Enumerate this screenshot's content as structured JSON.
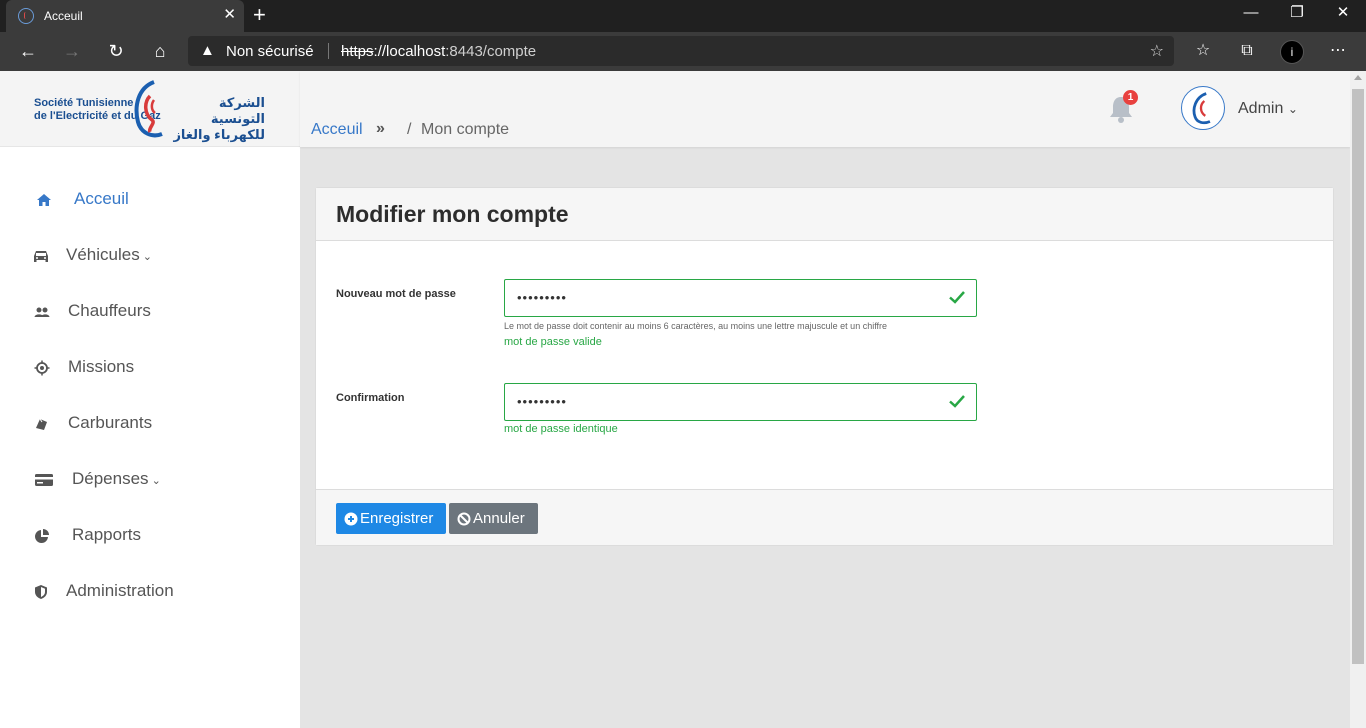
{
  "browser": {
    "tab_title": "Acceuil",
    "tab_close": "✕",
    "new_tab": "+",
    "security_label": "Non sécurisé",
    "url_scheme": "https",
    "url_host": "://localhost",
    "url_rest": ":8443/compte",
    "window_controls": [
      "—",
      "❐",
      "✕"
    ]
  },
  "logo": {
    "name_fr_line1": "Société Tunisienne",
    "name_fr_line2": "de l'Electricité et du Gaz",
    "name_ar_line1": "الشركة التونسية",
    "name_ar_line2": "للكهرباء والغاز"
  },
  "sidebar": {
    "items": [
      {
        "label": "Acceuil",
        "icon": "home-icon",
        "active": true
      },
      {
        "label": "Véhicules",
        "icon": "car-icon",
        "caret": "⌄"
      },
      {
        "label": "Chauffeurs",
        "icon": "people-icon"
      },
      {
        "label": "Missions",
        "icon": "target-icon"
      },
      {
        "label": "Carburants",
        "icon": "fuel-icon"
      },
      {
        "label": "Dépenses",
        "icon": "credit-card-icon",
        "caret": "⌄"
      },
      {
        "label": "Rapports",
        "icon": "pie-chart-icon"
      },
      {
        "label": "Administration",
        "icon": "shield-icon"
      }
    ]
  },
  "header": {
    "breadcrumb_home": "Acceuil",
    "breadcrumb_chevron": "»",
    "breadcrumb_separator": "/",
    "breadcrumb_current": "Mon compte",
    "notification_count": "1",
    "user_name": "Admin",
    "user_caret": "⌄"
  },
  "form": {
    "title": "Modifier mon compte",
    "password_label": "Nouveau mot de passe",
    "password_value": "•••••••••",
    "password_hint": "Le mot de passe doit contenir au moins 6 caractères, au moins une lettre majuscule et un chiffre",
    "password_valid": "mot de passe valide",
    "confirm_label": "Confirmation",
    "confirm_value": "•••••••••",
    "confirm_valid": "mot de passe identique",
    "save_label": "Enregistrer",
    "cancel_label": "Annuler",
    "valid_color": "#28a745",
    "primary_color": "#1e88e5"
  }
}
